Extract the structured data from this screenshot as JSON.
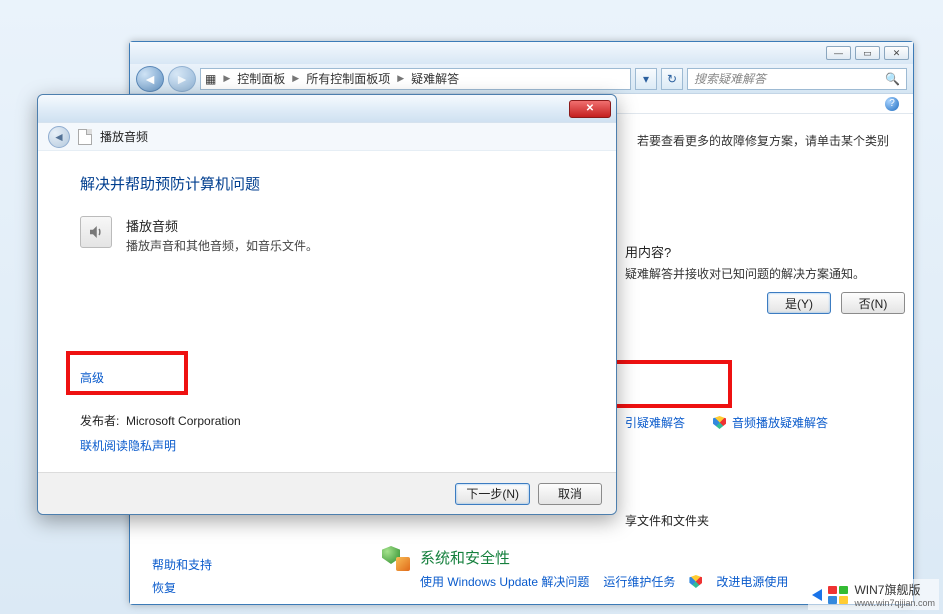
{
  "parent": {
    "breadcrumb": {
      "a": "控制面板",
      "b": "所有控制面板项",
      "c": "疑难解答"
    },
    "search_placeholder": "搜索疑难解答",
    "hint": "若要查看更多的故障修复方案，请单击某个类别",
    "prompt": {
      "title_suffix": "用内容?",
      "sub": "疑难解答并接收对已知问题的解决方案通知。",
      "yes": "是(Y)",
      "no": "否(N)"
    },
    "ts": {
      "link1_suffix": "引疑难解答",
      "link2": "音频播放疑难解答"
    },
    "share_suffix": "享文件和文件夹",
    "sidebar": {
      "help": "帮助和支持",
      "recover": "恢复"
    },
    "syssec": {
      "title": "系统和安全性",
      "l1": "使用 Windows Update 解决问题",
      "l2": "运行维护任务",
      "l3": "改进电源使用"
    }
  },
  "dialog": {
    "header_title": "播放音频",
    "main_title": "解决并帮助预防计算机问题",
    "audio_title": "播放音频",
    "audio_sub": "播放声音和其他音频，如音乐文件。",
    "advanced": "高级",
    "publisher_label": "发布者:",
    "publisher_value": "Microsoft Corporation",
    "privacy": "联机阅读隐私声明",
    "next": "下一步(N)",
    "cancel": "取消"
  },
  "watermark": {
    "title": "WIN7旗舰版",
    "url": "www.win7qijian.com"
  }
}
